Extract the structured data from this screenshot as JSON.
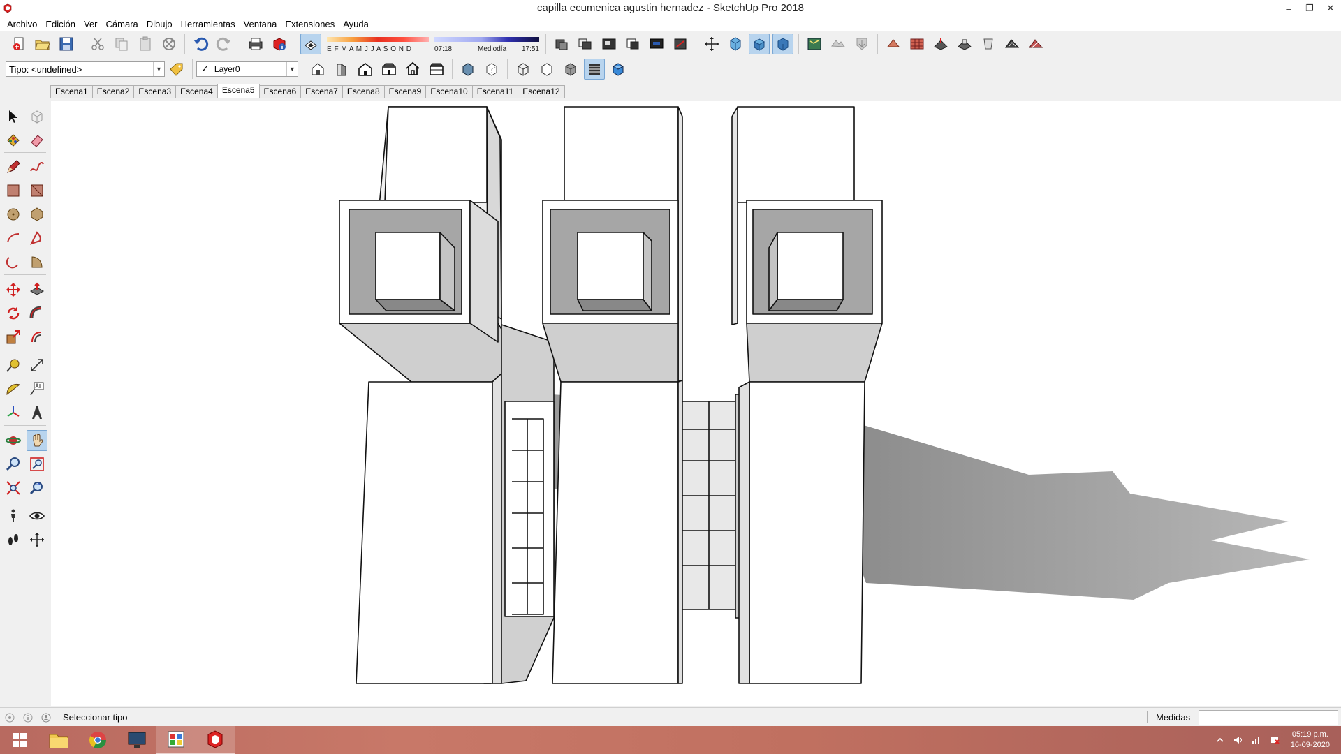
{
  "window": {
    "title": "capilla ecumenica agustin hernadez - SketchUp Pro 2018",
    "minimize": "–",
    "restore": "❐",
    "close": "✕"
  },
  "menu": [
    "Archivo",
    "Edición",
    "Ver",
    "Cámara",
    "Dibujo",
    "Herramientas",
    "Ventana",
    "Extensiones",
    "Ayuda"
  ],
  "shadows": {
    "months": "E F M A M J J A S O N D",
    "time_start": "07:18",
    "time_mid": "Mediodía",
    "time_end": "17:51"
  },
  "tag_combo": {
    "value": "Tipo: <undefined>"
  },
  "layer_combo": {
    "check": "✓",
    "value": "Layer0"
  },
  "scenes": {
    "tabs": [
      "Escena1",
      "Escena2",
      "Escena3",
      "Escena4",
      "Escena5",
      "Escena6",
      "Escena7",
      "Escena8",
      "Escena9",
      "Escena10",
      "Escena11",
      "Escena12"
    ],
    "active": "Escena5"
  },
  "status": {
    "text": "Seleccionar tipo",
    "measure_label": "Medidas",
    "measure_value": ""
  },
  "clock": {
    "time": "05:19 p.m.",
    "date": "16-09-2020"
  },
  "colors": {
    "accent": "#b8d4ee",
    "taskbar": "#c07060",
    "shadow": "#a0a0a0",
    "wall": "#ffffff"
  }
}
